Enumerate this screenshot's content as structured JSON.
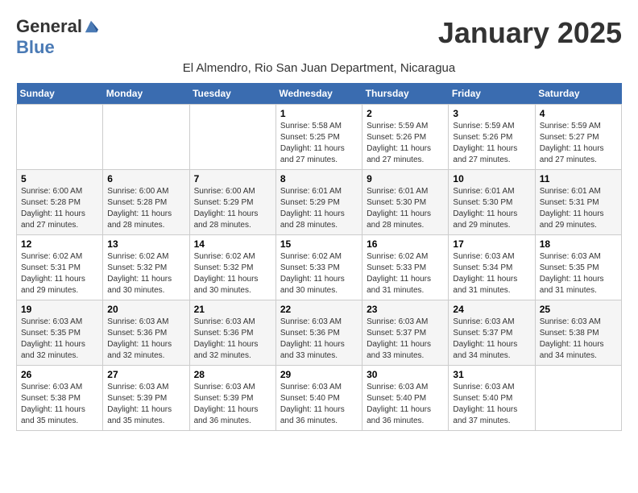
{
  "header": {
    "logo_general": "General",
    "logo_blue": "Blue",
    "month": "January 2025",
    "subtitle": "El Almendro, Rio San Juan Department, Nicaragua"
  },
  "days_of_week": [
    "Sunday",
    "Monday",
    "Tuesday",
    "Wednesday",
    "Thursday",
    "Friday",
    "Saturday"
  ],
  "weeks": [
    [
      {
        "day": "",
        "content": ""
      },
      {
        "day": "",
        "content": ""
      },
      {
        "day": "",
        "content": ""
      },
      {
        "day": "1",
        "content": "Sunrise: 5:58 AM\nSunset: 5:25 PM\nDaylight: 11 hours\nand 27 minutes."
      },
      {
        "day": "2",
        "content": "Sunrise: 5:59 AM\nSunset: 5:26 PM\nDaylight: 11 hours\nand 27 minutes."
      },
      {
        "day": "3",
        "content": "Sunrise: 5:59 AM\nSunset: 5:26 PM\nDaylight: 11 hours\nand 27 minutes."
      },
      {
        "day": "4",
        "content": "Sunrise: 5:59 AM\nSunset: 5:27 PM\nDaylight: 11 hours\nand 27 minutes."
      }
    ],
    [
      {
        "day": "5",
        "content": "Sunrise: 6:00 AM\nSunset: 5:28 PM\nDaylight: 11 hours\nand 27 minutes."
      },
      {
        "day": "6",
        "content": "Sunrise: 6:00 AM\nSunset: 5:28 PM\nDaylight: 11 hours\nand 28 minutes."
      },
      {
        "day": "7",
        "content": "Sunrise: 6:00 AM\nSunset: 5:29 PM\nDaylight: 11 hours\nand 28 minutes."
      },
      {
        "day": "8",
        "content": "Sunrise: 6:01 AM\nSunset: 5:29 PM\nDaylight: 11 hours\nand 28 minutes."
      },
      {
        "day": "9",
        "content": "Sunrise: 6:01 AM\nSunset: 5:30 PM\nDaylight: 11 hours\nand 28 minutes."
      },
      {
        "day": "10",
        "content": "Sunrise: 6:01 AM\nSunset: 5:30 PM\nDaylight: 11 hours\nand 29 minutes."
      },
      {
        "day": "11",
        "content": "Sunrise: 6:01 AM\nSunset: 5:31 PM\nDaylight: 11 hours\nand 29 minutes."
      }
    ],
    [
      {
        "day": "12",
        "content": "Sunrise: 6:02 AM\nSunset: 5:31 PM\nDaylight: 11 hours\nand 29 minutes."
      },
      {
        "day": "13",
        "content": "Sunrise: 6:02 AM\nSunset: 5:32 PM\nDaylight: 11 hours\nand 30 minutes."
      },
      {
        "day": "14",
        "content": "Sunrise: 6:02 AM\nSunset: 5:32 PM\nDaylight: 11 hours\nand 30 minutes."
      },
      {
        "day": "15",
        "content": "Sunrise: 6:02 AM\nSunset: 5:33 PM\nDaylight: 11 hours\nand 30 minutes."
      },
      {
        "day": "16",
        "content": "Sunrise: 6:02 AM\nSunset: 5:33 PM\nDaylight: 11 hours\nand 31 minutes."
      },
      {
        "day": "17",
        "content": "Sunrise: 6:03 AM\nSunset: 5:34 PM\nDaylight: 11 hours\nand 31 minutes."
      },
      {
        "day": "18",
        "content": "Sunrise: 6:03 AM\nSunset: 5:35 PM\nDaylight: 11 hours\nand 31 minutes."
      }
    ],
    [
      {
        "day": "19",
        "content": "Sunrise: 6:03 AM\nSunset: 5:35 PM\nDaylight: 11 hours\nand 32 minutes."
      },
      {
        "day": "20",
        "content": "Sunrise: 6:03 AM\nSunset: 5:36 PM\nDaylight: 11 hours\nand 32 minutes."
      },
      {
        "day": "21",
        "content": "Sunrise: 6:03 AM\nSunset: 5:36 PM\nDaylight: 11 hours\nand 32 minutes."
      },
      {
        "day": "22",
        "content": "Sunrise: 6:03 AM\nSunset: 5:36 PM\nDaylight: 11 hours\nand 33 minutes."
      },
      {
        "day": "23",
        "content": "Sunrise: 6:03 AM\nSunset: 5:37 PM\nDaylight: 11 hours\nand 33 minutes."
      },
      {
        "day": "24",
        "content": "Sunrise: 6:03 AM\nSunset: 5:37 PM\nDaylight: 11 hours\nand 34 minutes."
      },
      {
        "day": "25",
        "content": "Sunrise: 6:03 AM\nSunset: 5:38 PM\nDaylight: 11 hours\nand 34 minutes."
      }
    ],
    [
      {
        "day": "26",
        "content": "Sunrise: 6:03 AM\nSunset: 5:38 PM\nDaylight: 11 hours\nand 35 minutes."
      },
      {
        "day": "27",
        "content": "Sunrise: 6:03 AM\nSunset: 5:39 PM\nDaylight: 11 hours\nand 35 minutes."
      },
      {
        "day": "28",
        "content": "Sunrise: 6:03 AM\nSunset: 5:39 PM\nDaylight: 11 hours\nand 36 minutes."
      },
      {
        "day": "29",
        "content": "Sunrise: 6:03 AM\nSunset: 5:40 PM\nDaylight: 11 hours\nand 36 minutes."
      },
      {
        "day": "30",
        "content": "Sunrise: 6:03 AM\nSunset: 5:40 PM\nDaylight: 11 hours\nand 36 minutes."
      },
      {
        "day": "31",
        "content": "Sunrise: 6:03 AM\nSunset: 5:40 PM\nDaylight: 11 hours\nand 37 minutes."
      },
      {
        "day": "",
        "content": ""
      }
    ]
  ]
}
